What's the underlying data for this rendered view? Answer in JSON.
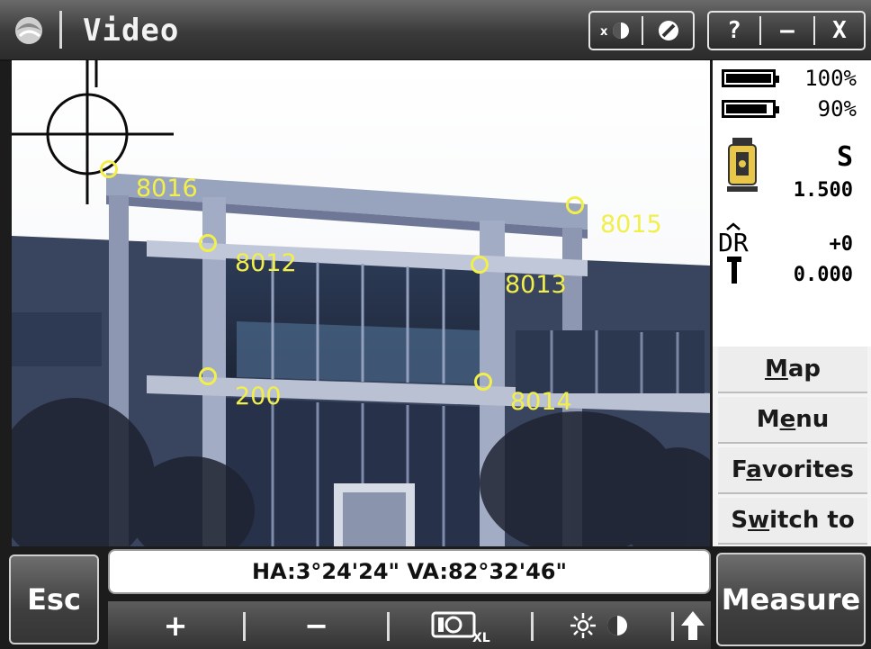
{
  "window": {
    "title": "Video",
    "buttons": {
      "help": "?",
      "minimize": "—",
      "close": "X"
    },
    "icons": [
      "trimble-logo-icon",
      "target-dr-toggle-icon",
      "level-bubble-icon"
    ]
  },
  "video": {
    "points": [
      {
        "label": "8016"
      },
      {
        "label": "8015"
      },
      {
        "label": "8012"
      },
      {
        "label": "8013"
      },
      {
        "label": "200"
      },
      {
        "label": "8014"
      }
    ],
    "marker_color": "#f2ef4a"
  },
  "status": {
    "battery_1": {
      "percent": "100%",
      "level": 1.0
    },
    "battery_2": {
      "percent": "90%",
      "level": 0.9
    },
    "instrument_face": "S",
    "target_height": "1.500",
    "dr_label": "DR",
    "prism_constant": "+0",
    "dr_height": "0.000"
  },
  "softkeys": {
    "map": {
      "label": "Map",
      "hotkey": "M"
    },
    "menu": {
      "label": "Menu",
      "hotkey": "e"
    },
    "favorites": {
      "label": "Favorites",
      "hotkey": "a"
    },
    "switch_to": {
      "label": "Switch to",
      "hotkey": "w"
    }
  },
  "angles": "HA:3°24'24\"  VA:82°32'46\"",
  "buttons": {
    "esc": "Esc",
    "measure": "Measure"
  },
  "toolbar": {
    "zoom_in": "+",
    "zoom_out": "−",
    "camera_icon": "camera-xl-icon",
    "brightness_icon": "brightness-contrast-icon",
    "expand_icon": "arrow-up-icon"
  }
}
